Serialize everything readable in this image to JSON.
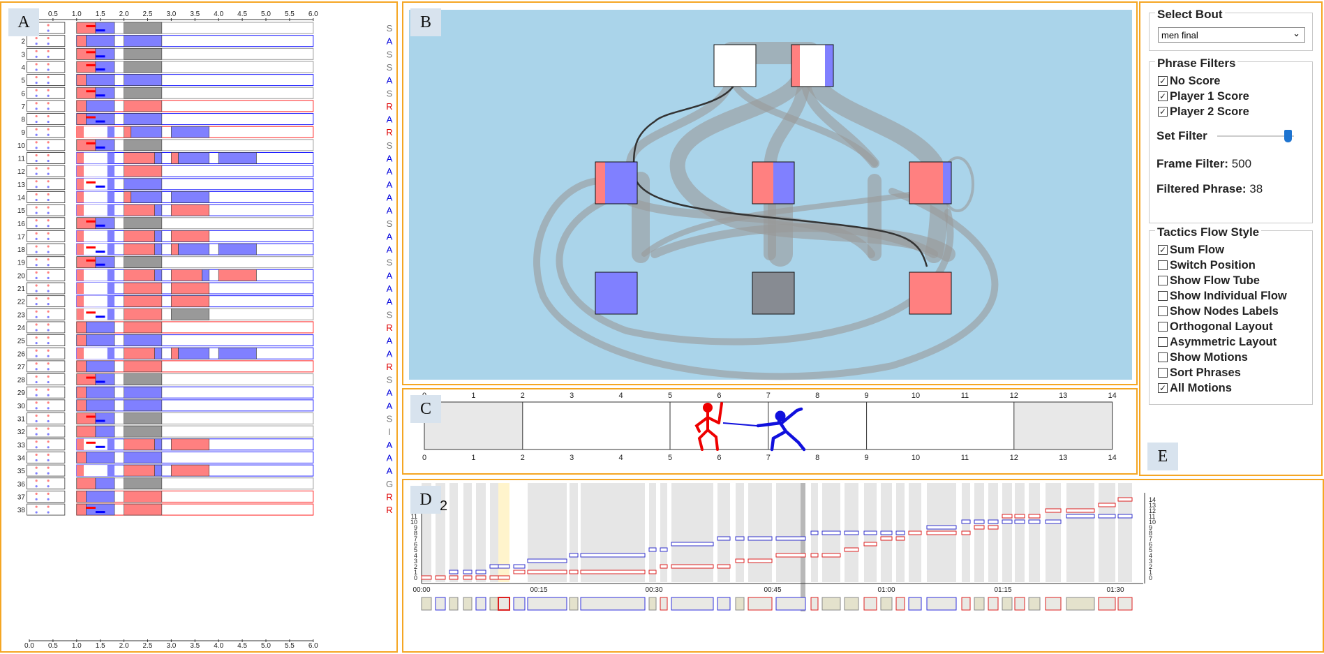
{
  "panels": {
    "a": "A",
    "b": "B",
    "c": "C",
    "d": "D",
    "e": "E"
  },
  "phrase_list": {
    "axis_ticks": [
      "0.0",
      "0.5",
      "1.0",
      "1.5",
      "2.0",
      "2.5",
      "3.0",
      "3.5",
      "4.0",
      "4.5",
      "5.0",
      "5.5",
      "6.0"
    ],
    "rows": [
      {
        "n": "",
        "r": "S"
      },
      {
        "n": "2",
        "r": "A"
      },
      {
        "n": "3",
        "r": "S"
      },
      {
        "n": "4",
        "r": "S"
      },
      {
        "n": "5",
        "r": "A"
      },
      {
        "n": "6",
        "r": "S"
      },
      {
        "n": "7",
        "r": "R"
      },
      {
        "n": "8",
        "r": "A"
      },
      {
        "n": "9",
        "r": "R"
      },
      {
        "n": "10",
        "r": "S"
      },
      {
        "n": "11",
        "r": "A"
      },
      {
        "n": "12",
        "r": "A"
      },
      {
        "n": "13",
        "r": "A"
      },
      {
        "n": "14",
        "r": "A"
      },
      {
        "n": "15",
        "r": "A"
      },
      {
        "n": "16",
        "r": "S"
      },
      {
        "n": "17",
        "r": "A"
      },
      {
        "n": "18",
        "r": "A"
      },
      {
        "n": "19",
        "r": "S"
      },
      {
        "n": "20",
        "r": "A"
      },
      {
        "n": "21",
        "r": "A"
      },
      {
        "n": "22",
        "r": "A"
      },
      {
        "n": "23",
        "r": "S"
      },
      {
        "n": "24",
        "r": "R"
      },
      {
        "n": "25",
        "r": "A"
      },
      {
        "n": "26",
        "r": "A"
      },
      {
        "n": "27",
        "r": "R"
      },
      {
        "n": "28",
        "r": "S"
      },
      {
        "n": "29",
        "r": "A"
      },
      {
        "n": "30",
        "r": "A"
      },
      {
        "n": "31",
        "r": "S"
      },
      {
        "n": "32",
        "r": "I"
      },
      {
        "n": "33",
        "r": "A"
      },
      {
        "n": "34",
        "r": "A"
      },
      {
        "n": "35",
        "r": "A"
      },
      {
        "n": "36",
        "r": "G"
      },
      {
        "n": "37",
        "r": "R"
      },
      {
        "n": "38",
        "r": "R"
      }
    ]
  },
  "piste": {
    "ticks": [
      "0",
      "1",
      "2",
      "3",
      "4",
      "5",
      "6",
      "7",
      "8",
      "9",
      "10",
      "11",
      "12",
      "13",
      "14"
    ]
  },
  "timeline": {
    "number": "2",
    "time_labels": [
      "00:00",
      "00:15",
      "00:30",
      "00:45",
      "01:00",
      "01:15",
      "01:30"
    ],
    "y_ticks_left": [
      "0",
      "1",
      "2",
      "3",
      "4",
      "5",
      "6",
      "7",
      "8",
      "9",
      "10",
      "11"
    ],
    "y_ticks_right": [
      "0",
      "1",
      "2",
      "3",
      "4",
      "5",
      "6",
      "7",
      "8",
      "9",
      "10",
      "11",
      "12",
      "13",
      "14"
    ]
  },
  "controls": {
    "select_bout": {
      "title": "Select Bout",
      "value": "men final"
    },
    "phrase_filters": {
      "title": "Phrase Filters",
      "items": [
        {
          "label": "No Score",
          "checked": true
        },
        {
          "label": "Player 1 Score",
          "checked": true
        },
        {
          "label": "Player 2 Score",
          "checked": true
        }
      ]
    },
    "set_filter_label": "Set Filter",
    "frame_filter_label": "Frame Filter:",
    "frame_filter_value": "500",
    "filtered_phrase_label": "Filtered Phrase:",
    "filtered_phrase_value": "38",
    "tactics": {
      "title": "Tactics Flow Style",
      "items": [
        {
          "label": "Sum Flow",
          "checked": true
        },
        {
          "label": "Switch Position",
          "checked": false
        },
        {
          "label": "Show Flow Tube",
          "checked": false
        },
        {
          "label": "Show Individual Flow",
          "checked": false
        },
        {
          "label": "Show Nodes Labels",
          "checked": false
        },
        {
          "label": "Orthogonal Layout",
          "checked": false
        },
        {
          "label": "Asymmetric Layout",
          "checked": false
        },
        {
          "label": "Show Motions",
          "checked": false
        },
        {
          "label": "Sort Phrases",
          "checked": false
        },
        {
          "label": "All Motions",
          "checked": true
        }
      ]
    }
  },
  "colors": {
    "red": "#ff8080",
    "blue": "#8080ff",
    "gray": "#999999",
    "orange": "#f5a623",
    "flow_bg": "#aad4ea"
  }
}
